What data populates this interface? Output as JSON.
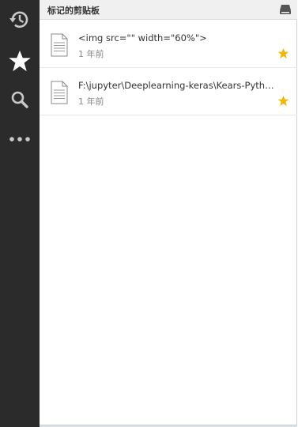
{
  "header": {
    "title": "标记的剪贴板"
  },
  "sidebar": {
    "items": [
      {
        "name": "history",
        "icon": "history-icon"
      },
      {
        "name": "starred",
        "icon": "star-icon",
        "active": true
      },
      {
        "name": "search",
        "icon": "search-icon"
      },
      {
        "name": "more",
        "icon": "more-icon"
      }
    ]
  },
  "clips": [
    {
      "text": "<img src=\"\" width=\"60%\">",
      "time": "1 年前",
      "starred": true
    },
    {
      "text": "F:\\jupyter\\Deeplearning-keras\\Kears-Python-tut…",
      "time": "1 年前",
      "starred": true
    }
  ],
  "colors": {
    "sidebar_bg": "#2b2b2b",
    "star": "#f2b600",
    "sidebar_icon": "#c8c8c8"
  }
}
